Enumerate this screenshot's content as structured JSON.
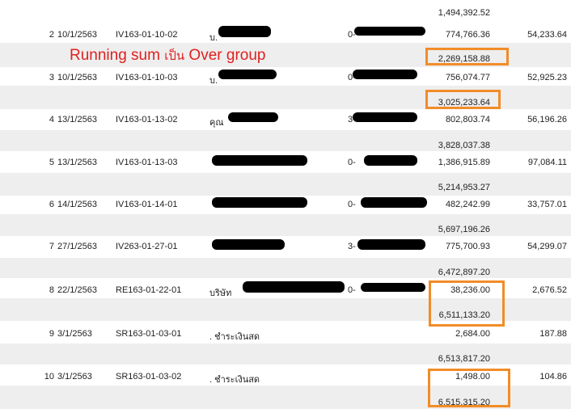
{
  "annotation": {
    "prefix": "Running sum",
    "thai": "เป็น",
    "suffix": "Over group"
  },
  "top_running": "1,494,392.52",
  "rows": [
    {
      "no": "2",
      "date": "10/1/2563",
      "doc": "IV163-01-10-02",
      "name": "บ.",
      "id": "0-",
      "amount": "774,766.36",
      "vat": "54,233.64",
      "running": "2,269,158.88"
    },
    {
      "no": "3",
      "date": "10/1/2563",
      "doc": "IV163-01-10-03",
      "name": "บ.",
      "id": "0-",
      "amount": "756,074.77",
      "vat": "52,925.23",
      "running": "3,025,233.64"
    },
    {
      "no": "4",
      "date": "13/1/2563",
      "doc": "IV163-01-13-02",
      "name": "คุณ",
      "id": "3-",
      "amount": "802,803.74",
      "vat": "56,196.26",
      "running": "3,828,037.38"
    },
    {
      "no": "5",
      "date": "13/1/2563",
      "doc": "IV163-01-13-03",
      "name": "",
      "id": "0-",
      "amount": "1,386,915.89",
      "vat": "97,084.11",
      "running": "5,214,953.27"
    },
    {
      "no": "6",
      "date": "14/1/2563",
      "doc": "IV163-01-14-01",
      "name": "",
      "id": "0-",
      "amount": "482,242.99",
      "vat": "33,757.01",
      "running": "5,697,196.26"
    },
    {
      "no": "7",
      "date": "27/1/2563",
      "doc": "IV263-01-27-01",
      "name": "",
      "id": "3-",
      "amount": "775,700.93",
      "vat": "54,299.07",
      "running": "6,472,897.20"
    },
    {
      "no": "8",
      "date": "22/1/2563",
      "doc": "RE163-01-22-01",
      "name": "บริษัท",
      "id": "0-",
      "amount": "38,236.00",
      "vat": "2,676.52",
      "running": "6,511,133.20"
    },
    {
      "no": "9",
      "date": "3/1/2563",
      "doc": "SR163-01-03-01",
      "name": ". ชำระเงินสด",
      "id": "",
      "amount": "2,684.00",
      "vat": "187.88",
      "running": "6,513,817.20"
    },
    {
      "no": "10",
      "date": "3/1/2563",
      "doc": "SR163-01-03-02",
      "name": ". ชำระเงินสด",
      "id": "",
      "amount": "1,498.00",
      "vat": "104.86",
      "running": "6,515,315.20"
    }
  ]
}
